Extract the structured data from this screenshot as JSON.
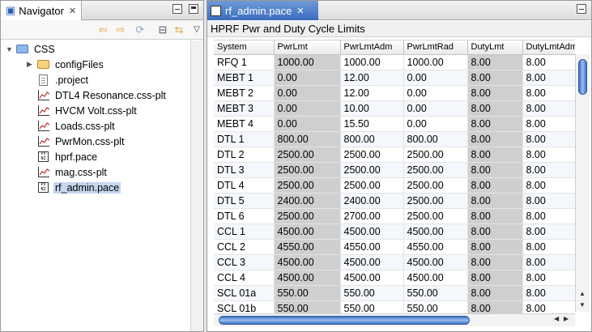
{
  "navigator": {
    "tab_label": "Navigator",
    "close_glyph": "✕",
    "toolbar": {
      "back_glyph": "⇦",
      "forward_glyph": "⇨",
      "up_glyph": "⟳",
      "collapse_glyph": "⊟",
      "link_glyph": "⇆",
      "menu_glyph": "▽"
    },
    "tree": [
      {
        "label": "CSS",
        "icon": "folder-icon",
        "expanded": true
      },
      {
        "label": "configFiles",
        "icon": "folder-icon"
      },
      {
        "label": ".project",
        "icon": "document-icon"
      },
      {
        "label": "DTL4 Resonance.css-plt",
        "icon": "plot-icon"
      },
      {
        "label": "HVCM Volt.css-plt",
        "icon": "plot-icon"
      },
      {
        "label": "Loads.css-plt",
        "icon": "plot-icon"
      },
      {
        "label": "PwrMon.css-plt",
        "icon": "plot-icon"
      },
      {
        "label": "hprf.pace",
        "icon": "pace-icon"
      },
      {
        "label": "mag.css-plt",
        "icon": "plot-icon"
      },
      {
        "label": "rf_admin.pace",
        "icon": "pace-icon",
        "selected": true
      }
    ]
  },
  "editor": {
    "tab_label": "rf_admin.pace",
    "close_glyph": "✕",
    "title": "HPRF Pwr and Duty Cycle Limits",
    "columns": [
      "System",
      "PwrLmt",
      "PwrLmtAdm",
      "PwrLmtRad",
      "DutyLmt",
      "DutyLmtAdm"
    ],
    "rows": [
      [
        "RFQ 1",
        "1000.00",
        "1000.00",
        "1000.00",
        "8.00",
        "8.00"
      ],
      [
        "MEBT 1",
        "0.00",
        "12.00",
        "0.00",
        "8.00",
        "8.00"
      ],
      [
        "MEBT 2",
        "0.00",
        "12.00",
        "0.00",
        "8.00",
        "8.00"
      ],
      [
        "MEBT 3",
        "0.00",
        "10.00",
        "0.00",
        "8.00",
        "8.00"
      ],
      [
        "MEBT 4",
        "0.00",
        "15.50",
        "0.00",
        "8.00",
        "8.00"
      ],
      [
        "DTL 1",
        "800.00",
        "800.00",
        "800.00",
        "8.00",
        "8.00"
      ],
      [
        "DTL 2",
        "2500.00",
        "2500.00",
        "2500.00",
        "8.00",
        "8.00"
      ],
      [
        "DTL 3",
        "2500.00",
        "2500.00",
        "2500.00",
        "8.00",
        "8.00"
      ],
      [
        "DTL 4",
        "2500.00",
        "2500.00",
        "2500.00",
        "8.00",
        "8.00"
      ],
      [
        "DTL 5",
        "2400.00",
        "2400.00",
        "2500.00",
        "8.00",
        "8.00"
      ],
      [
        "DTL 6",
        "2500.00",
        "2700.00",
        "2500.00",
        "8.00",
        "8.00"
      ],
      [
        "CCL 1",
        "4500.00",
        "4500.00",
        "4500.00",
        "8.00",
        "8.00"
      ],
      [
        "CCL 2",
        "4550.00",
        "4550.00",
        "4550.00",
        "8.00",
        "8.00"
      ],
      [
        "CCL 3",
        "4500.00",
        "4500.00",
        "4500.00",
        "8.00",
        "8.00"
      ],
      [
        "CCL 4",
        "4500.00",
        "4500.00",
        "4500.00",
        "8.00",
        "8.00"
      ],
      [
        "SCL 01a",
        "550.00",
        "550.00",
        "550.00",
        "8.00",
        "8.00"
      ],
      [
        "SCL 01b",
        "550.00",
        "550.00",
        "550.00",
        "8.00",
        "8.00"
      ]
    ],
    "shaded_columns": [
      1,
      4
    ]
  },
  "colors": {
    "active_tab": "#3a6cbd",
    "selection": "#c6d7ee",
    "shaded_cell": "#cfcfcf"
  }
}
